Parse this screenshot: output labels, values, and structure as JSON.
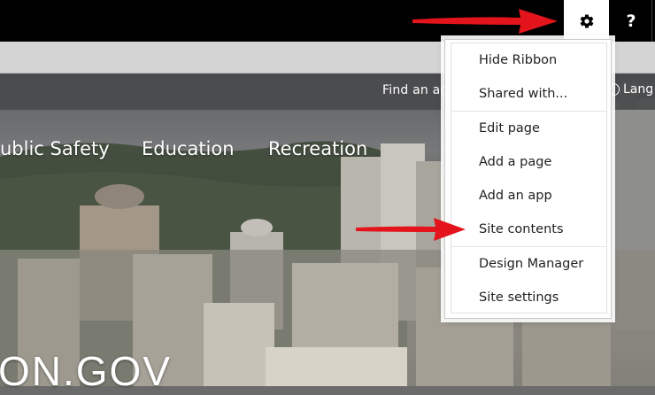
{
  "suitebar": {
    "settings_icon": "gear-icon",
    "help_label": "?"
  },
  "site": {
    "find_agency": "Find an age",
    "language": "Lang",
    "nav": [
      "ublic Safety",
      "Education",
      "Recreation"
    ],
    "hero_title": "ON.GOV"
  },
  "settings_menu": {
    "groups": [
      [
        "Hide Ribbon",
        "Shared with..."
      ],
      [
        "Edit page",
        "Add a page",
        "Add an app",
        "Site contents"
      ],
      [
        "Design Manager",
        "Site settings"
      ]
    ]
  },
  "colors": {
    "suitebar": "#000000",
    "arrow": "#e3141b",
    "menu_bg": "#ffffff"
  }
}
